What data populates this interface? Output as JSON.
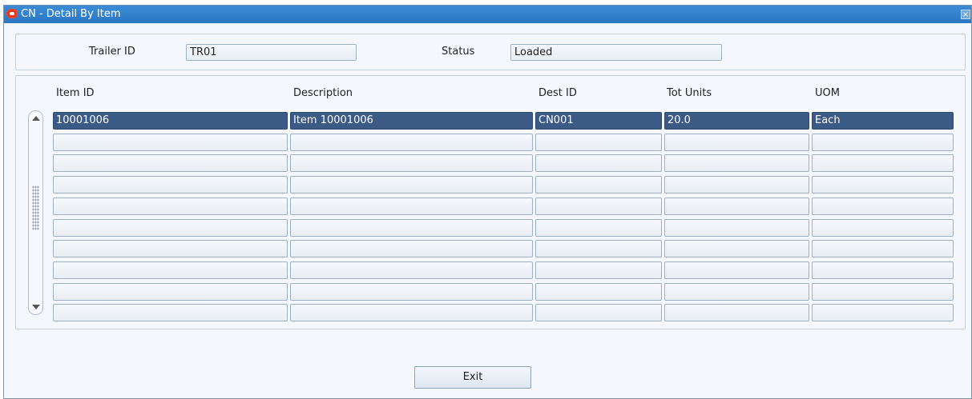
{
  "window": {
    "title": "CN - Detail By Item",
    "close_glyph": "×"
  },
  "header": {
    "trailer_label": "Trailer ID",
    "trailer_value": "TR01",
    "status_label": "Status",
    "status_value": "Loaded"
  },
  "grid": {
    "columns": [
      "Item ID",
      "Description",
      "Dest ID",
      "Tot Units",
      "UOM"
    ],
    "rows": [
      [
        "10001006",
        "Item 10001006",
        "CN001",
        "20.0",
        "Each"
      ],
      [
        "",
        "",
        "",
        "",
        ""
      ],
      [
        "",
        "",
        "",
        "",
        ""
      ],
      [
        "",
        "",
        "",
        "",
        ""
      ],
      [
        "",
        "",
        "",
        "",
        ""
      ],
      [
        "",
        "",
        "",
        "",
        ""
      ],
      [
        "",
        "",
        "",
        "",
        ""
      ],
      [
        "",
        "",
        "",
        "",
        ""
      ],
      [
        "",
        "",
        "",
        "",
        ""
      ],
      [
        "",
        "",
        "",
        "",
        ""
      ]
    ],
    "selected_row": 0
  },
  "buttons": {
    "exit_label": "Exit"
  },
  "icons": {
    "app_logo": "oracle-logo-icon",
    "close": "close-icon",
    "scroll_up": "scroll-up-arrow-icon",
    "scroll_down": "scroll-down-arrow-icon"
  },
  "colors": {
    "titlebar": "#2a77c2",
    "selected_row": "#3b5a86",
    "window_bg": "#f4f7fb"
  }
}
